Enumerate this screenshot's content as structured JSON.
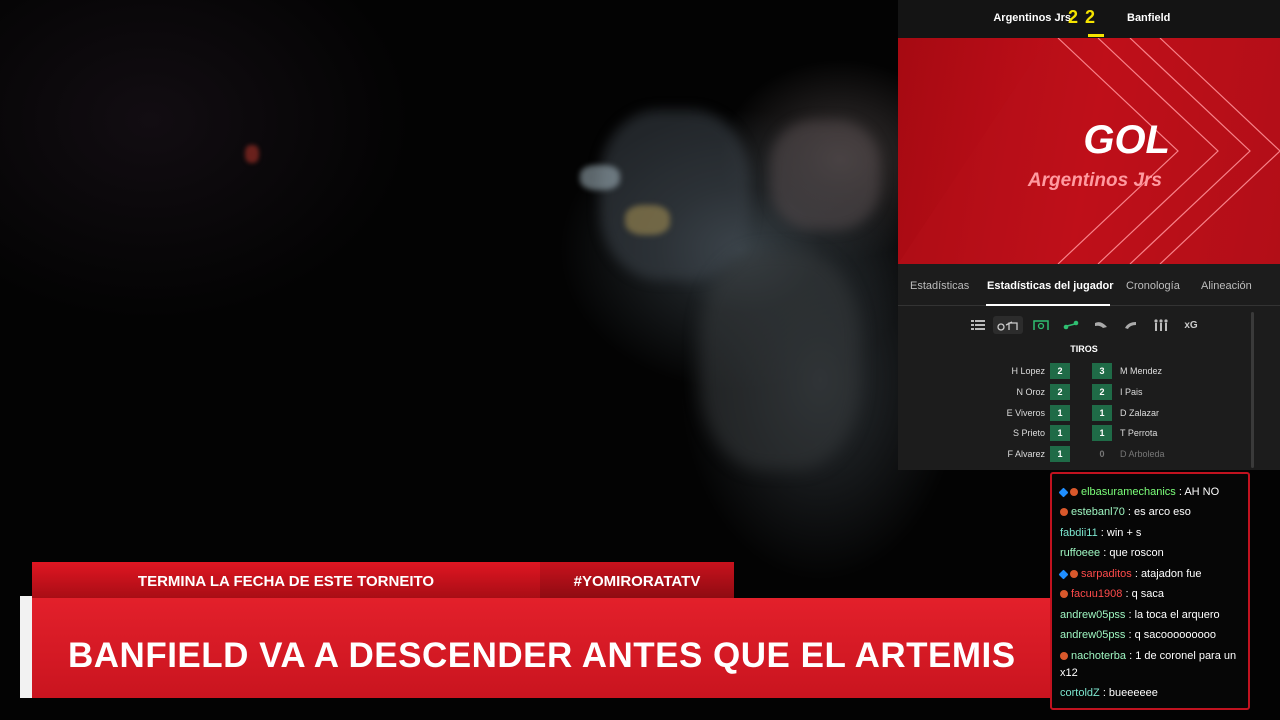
{
  "scoreboard": {
    "home_team": "Argentinos Jrs",
    "home_score": "2",
    "away_score": "2",
    "away_team": "Banfield",
    "accent_color": "#f5e400"
  },
  "goal_banner": {
    "title": "GOL",
    "team": "Argentinos Jrs",
    "color": "#c30f1a"
  },
  "tabs": [
    {
      "label": "Estadísticas"
    },
    {
      "label": "Estadísticas del jugador",
      "active": true
    },
    {
      "label": "Cronología"
    },
    {
      "label": "Alineación"
    }
  ],
  "stat_icons": [
    "list-icon",
    "shot-icon",
    "goal-frame-icon",
    "pass-icon",
    "tackle-icon",
    "foul-icon",
    "lineup-icon",
    "xG"
  ],
  "section_title": "TIROS",
  "players": [
    {
      "left_name": "H Lopez",
      "left_value": "2",
      "right_value": "3",
      "right_name": "M Mendez"
    },
    {
      "left_name": "N Oroz",
      "left_value": "2",
      "right_value": "2",
      "right_name": "I Pais"
    },
    {
      "left_name": "E Viveros",
      "left_value": "1",
      "right_value": "1",
      "right_name": "D Zalazar"
    },
    {
      "left_name": "S Prieto",
      "left_value": "1",
      "right_value": "1",
      "right_name": "T Perrota"
    },
    {
      "left_name": "F Alvarez",
      "left_value": "1",
      "right_value": "0",
      "right_name": "D Arboleda"
    }
  ],
  "chat": [
    {
      "user": "elbasuramechanics",
      "text": ": AH NO"
    },
    {
      "user": "estebanl70",
      "text": ": es arco eso"
    },
    {
      "user": "fabdii11",
      "text": ": win + s"
    },
    {
      "user": "ruffoeee",
      "text": ": que roscon"
    },
    {
      "user": "sarpaditos",
      "text": ": atajadon fue"
    },
    {
      "user": "facuu1908",
      "text": ": q saca"
    },
    {
      "user": "andrew05pss",
      "text": ": la toca el arquero"
    },
    {
      "user": "andrew05pss",
      "text": ": q sacooooooooo"
    },
    {
      "user": "nachoterba",
      "text": ": 1 de coronel para un x12"
    },
    {
      "user": "cortoldZ",
      "text": ": bueeeeee"
    }
  ],
  "lower_third": {
    "ticker": "TERMINA LA FECHA DE ESTE TORNEITO",
    "hashtag": "#YOMIRORATATV",
    "headline": "BANFIELD VA A DESCENDER ANTES QUE EL ARTEMIS",
    "color": "#e3202b"
  }
}
